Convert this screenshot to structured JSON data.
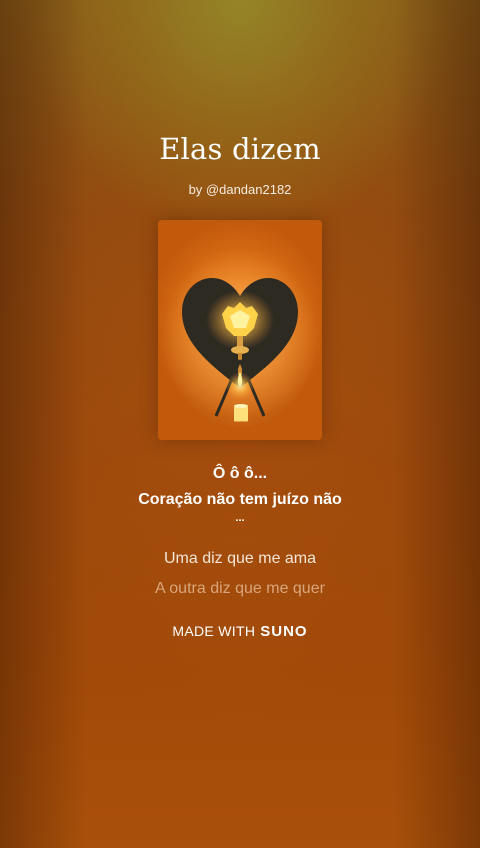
{
  "song": {
    "title": "Elas dizem",
    "author": "by @dandan2182"
  },
  "artwork": {
    "description_icon": "heart-candle-artwork",
    "colors": {
      "background": "#e07418",
      "heart": "#2d2a22",
      "flame": "#ffe070"
    }
  },
  "lyrics": {
    "current": [
      "Ô ô ô...",
      "Coração não tem juízo não",
      "..."
    ],
    "next": "Uma diz que me ama",
    "after": "A outra diz que me quer"
  },
  "footer": {
    "made_with": "MADE WITH",
    "brand": "SUNO"
  }
}
